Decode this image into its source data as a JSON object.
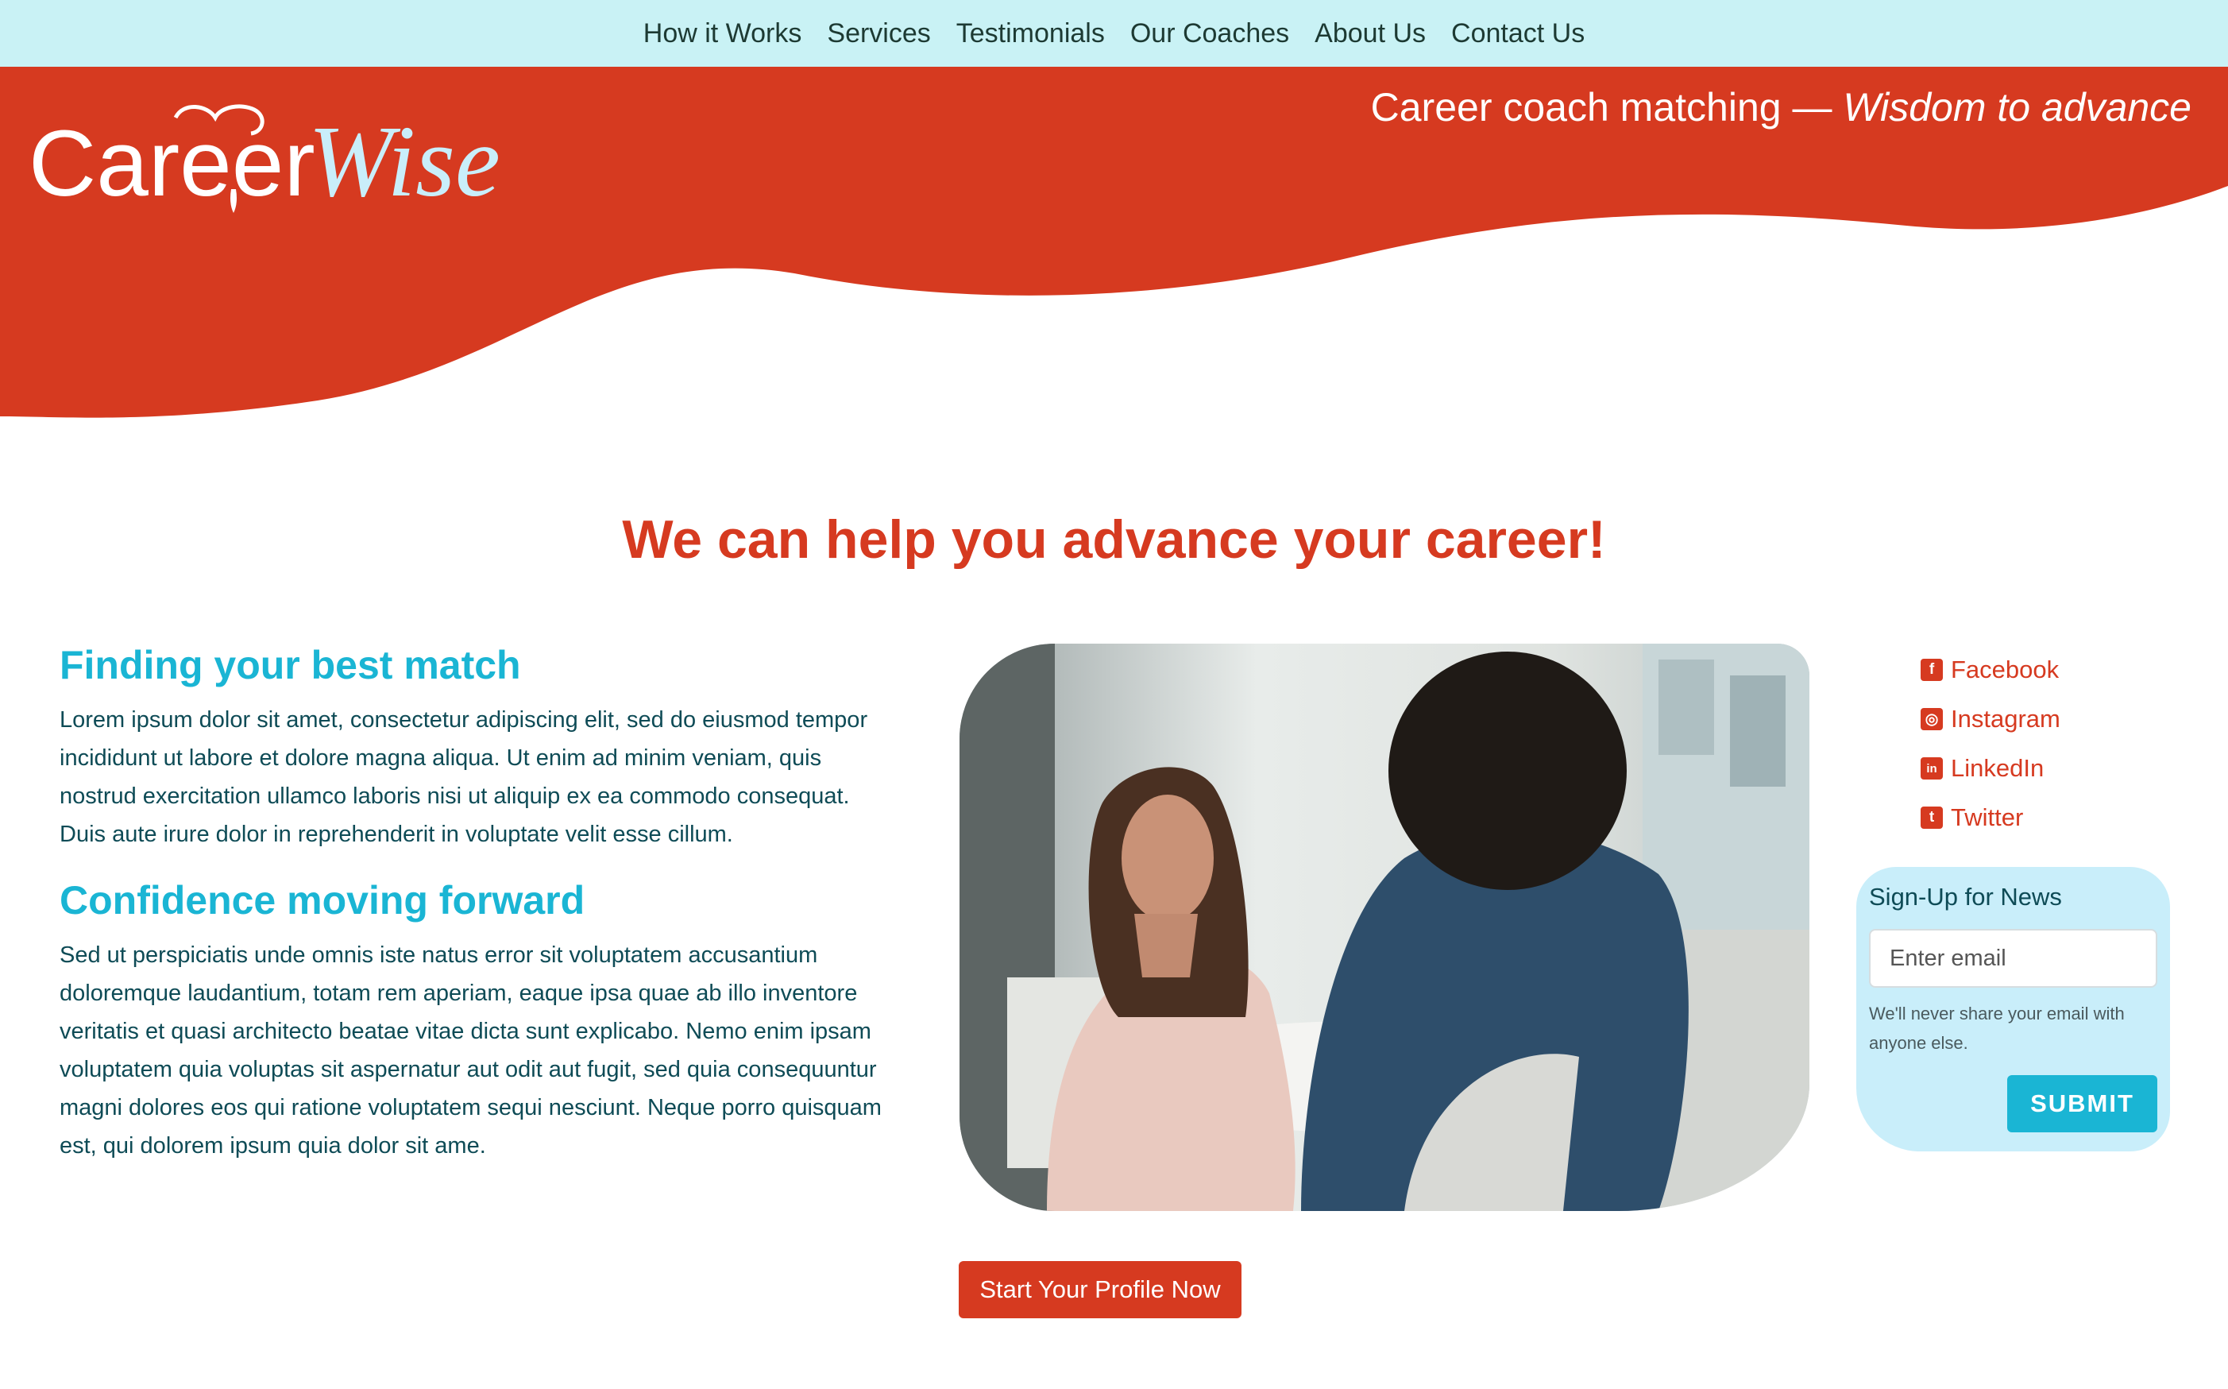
{
  "nav": {
    "items": [
      "How it Works",
      "Services",
      "Testimonials",
      "Our Coaches",
      "About Us",
      "Contact Us"
    ]
  },
  "brand": {
    "name_part1": "Career",
    "name_part2": "Wise"
  },
  "hero": {
    "tagline_plain": "Career coach matching — ",
    "tagline_italic": "Wisdom to advance",
    "headline": "We can help you advance your career!"
  },
  "sections": [
    {
      "title": "Finding your best match",
      "body": "Lorem ipsum dolor sit amet, consectetur adipiscing elit, sed do eiusmod tempor incididunt ut labore et dolore magna aliqua. Ut enim ad minim veniam, quis nostrud exercitation ullamco laboris nisi ut aliquip ex ea commodo consequat. Duis aute irure dolor in reprehenderit in voluptate velit esse cillum."
    },
    {
      "title": "Confidence moving forward",
      "body": "Sed ut perspiciatis unde omnis iste natus error sit voluptatem accusantium doloremque laudantium, totam rem aperiam, eaque ipsa quae ab illo inventore veritatis et quasi architecto beatae vitae dicta sunt explicabo. Nemo enim ipsam voluptatem quia voluptas sit aspernatur aut odit aut fugit, sed quia consequuntur magni dolores eos qui ratione voluptatem sequi nesciunt. Neque porro quisquam est, qui dolorem ipsum quia dolor sit ame."
    }
  ],
  "social": [
    {
      "label": "Facebook",
      "icon": "facebook-icon",
      "glyph": "f"
    },
    {
      "label": "Instagram",
      "icon": "instagram-icon",
      "glyph": "◎"
    },
    {
      "label": "LinkedIn",
      "icon": "linkedin-icon",
      "glyph": "in"
    },
    {
      "label": "Twitter",
      "icon": "twitter-icon",
      "glyph": "t"
    }
  ],
  "signup": {
    "title": "Sign-Up for News",
    "placeholder": "Enter email",
    "note": "We'll never share your email with anyone else.",
    "submit_label": "SUBMIT"
  },
  "cta": {
    "label": "Start Your Profile Now"
  },
  "colors": {
    "nav_bg": "#c9f2f5",
    "brand_red": "#d63a20",
    "accent_cyan": "#1ab5d4",
    "text_dark": "#0e4b56",
    "signup_bg": "#c9eefa"
  }
}
